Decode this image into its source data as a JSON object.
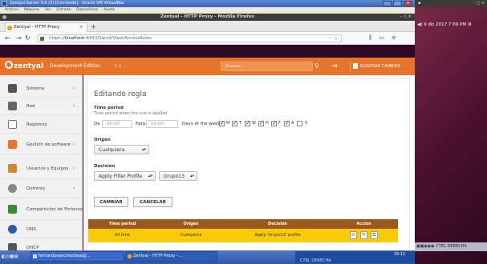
{
  "vbox": {
    "title": "Zentyal Server 5.0 (2) [Corriendo] - Oracle VM VirtualBox",
    "menu": [
      "Archivo",
      "Máquina",
      "Ver",
      "Entrada",
      "Dispositivos",
      "Ayuda"
    ]
  },
  "firefox": {
    "window_title": "Zentyal - HTTP Proxy - Mozilla Firefox",
    "tab_label": "Zentyal - HTTP Proxy",
    "url_prefix": "https://",
    "url_host": "localhost",
    "url_rest": ":8443/Squid/View/AccessRules"
  },
  "zentyal": {
    "brand": "zentyal",
    "edition": "Development Edition",
    "version": "5.0",
    "search_placeholder": "Buscar...",
    "save_label": "GUARDAR CAMBIOS"
  },
  "sidebar": {
    "items": [
      {
        "label": "Sistema",
        "icon": "gear-icon",
        "color": "#555555",
        "chevron": "‹"
      },
      {
        "label": "Red",
        "icon": "network-icon",
        "color": "#666666",
        "chevron": "‹"
      },
      {
        "label": "Registros",
        "icon": "log-icon",
        "color": "#777777",
        "chevron": ""
      },
      {
        "label": "Gestión de software",
        "icon": "software-icon",
        "color": "#e8732b",
        "chevron": "‹"
      },
      {
        "label": "Usuarios y Equipos",
        "icon": "users-icon",
        "color": "#d4862d",
        "chevron": "‹"
      },
      {
        "label": "Dominio",
        "icon": "domain-icon",
        "color": "#888888",
        "chevron": "‹"
      },
      {
        "label": "Compartición de Ficheros",
        "icon": "share-icon",
        "color": "#3a8a3a",
        "chevron": ""
      },
      {
        "label": "DNS",
        "icon": "dns-icon",
        "color": "#2a5caa",
        "chevron": ""
      },
      {
        "label": "DHCP",
        "icon": "dhcp-icon",
        "color": "#555555",
        "chevron": ""
      }
    ]
  },
  "form": {
    "heading": "Editando regla",
    "time_period_label": "Time period",
    "time_period_help": "Time period when the rule is applied",
    "de_label": "De",
    "para_label": "Para",
    "from_placeholder": "00:00",
    "to_placeholder": "00:00",
    "days_label": "Days of the week",
    "days": [
      "M",
      "T",
      "W",
      "H",
      "F",
      "A",
      "S"
    ],
    "days_checked": [
      true,
      true,
      true,
      true,
      true,
      true,
      false
    ],
    "origen_label": "Origen",
    "origen_value": "Cualquiera",
    "decision_label": "Decisión",
    "decision_value": "Apply Filter Profile",
    "profile_value": "Grupo13",
    "change_button": "CAMBIAR",
    "cancel_button": "CANCELAR"
  },
  "table": {
    "headers": [
      "Time period",
      "Origen",
      "Decisión",
      "Acción"
    ],
    "row": [
      "All time",
      "Cualquiera",
      "Apply 'Grupo13' profile"
    ]
  },
  "ubuntu": {
    "clock": "9 dic 2017  7:09 PM",
    "tray_text": "CTRL DERECHA"
  },
  "taskbar": {
    "task1": "fernandosanchezdaza@...",
    "task2": "Zentyal - HTTP Proxy - ...",
    "time": "19:12",
    "host_key": "CTRL DERECHA"
  }
}
